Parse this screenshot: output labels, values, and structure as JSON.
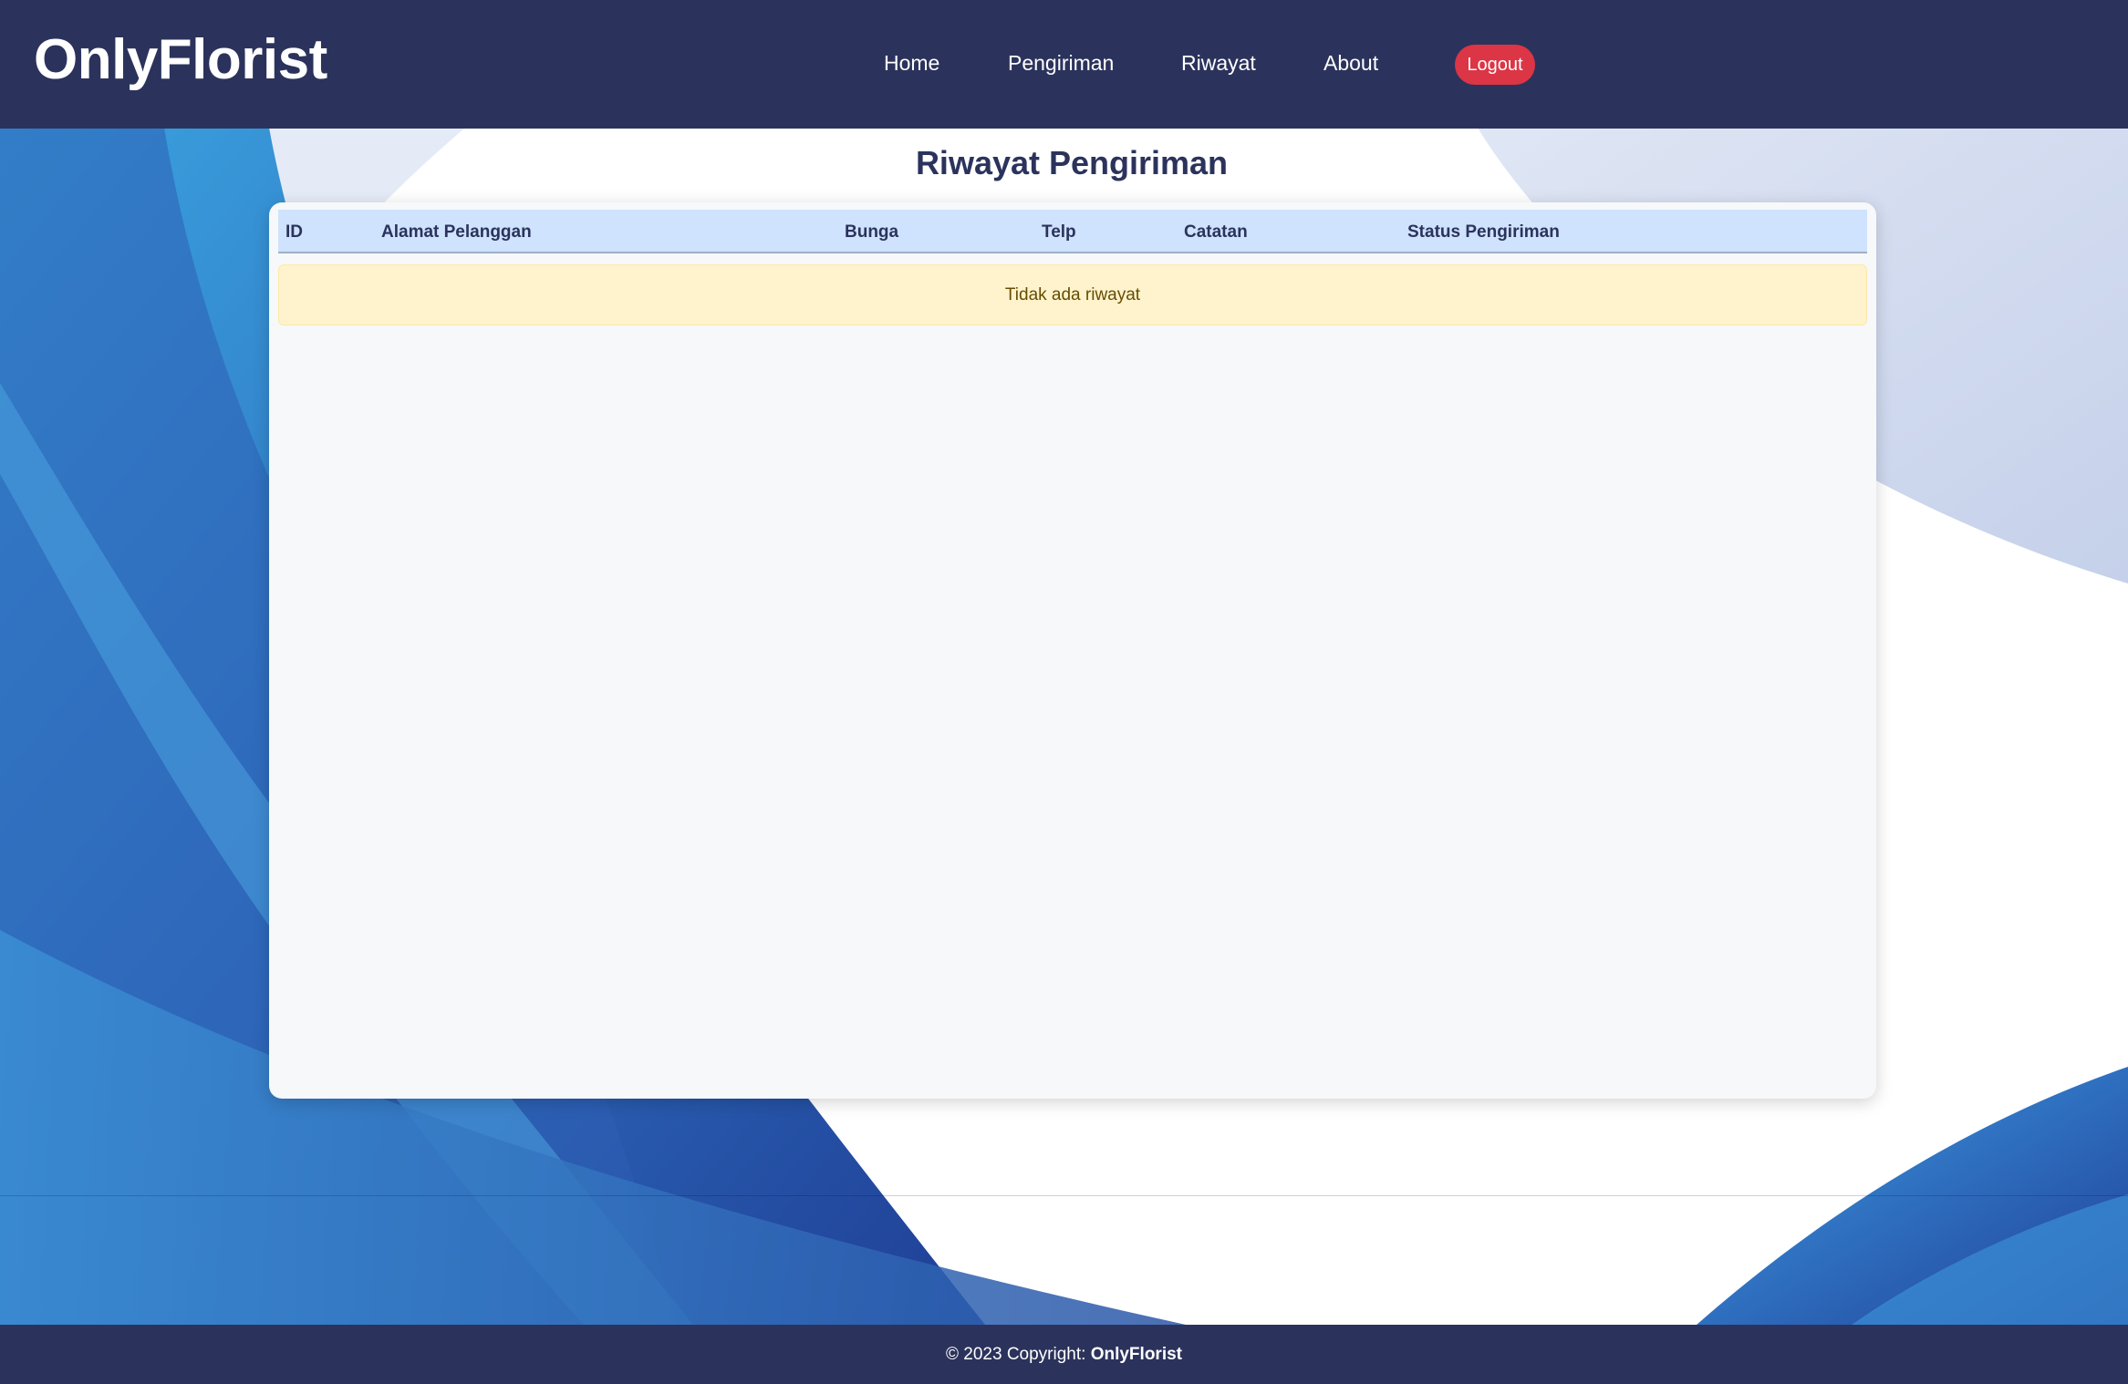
{
  "brand": {
    "name": "OnlyFlorist"
  },
  "nav": {
    "home": "Home",
    "pengiriman": "Pengiriman",
    "riwayat": "Riwayat",
    "about": "About",
    "logout": "Logout"
  },
  "page": {
    "title": "Riwayat Pengiriman"
  },
  "table": {
    "headers": [
      "ID",
      "Alamat Pelanggan",
      "Bunga",
      "Telp",
      "Catatan",
      "Status Pengiriman"
    ],
    "empty_message": "Tidak ada riwayat"
  },
  "footer": {
    "copyright": "© 2023 Copyright: ",
    "brand": "OnlyFlorist"
  },
  "colors": {
    "navbar": "#2b335c",
    "logout": "#dc3545",
    "table_header": "#cfe2fe",
    "alert": "#fff3cd"
  }
}
